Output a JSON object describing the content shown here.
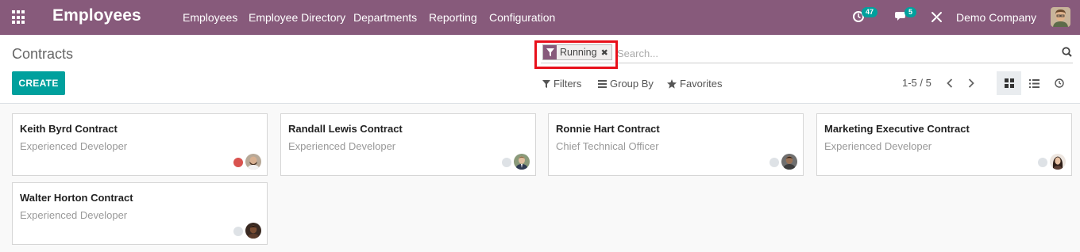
{
  "navbar": {
    "app_name": "Employees",
    "menu": [
      "Employees",
      "Employee Directory",
      "Departments",
      "Reporting",
      "Configuration"
    ],
    "activity_count": "47",
    "message_count": "5",
    "company": "Demo Company",
    "bg_color": "#875a7b"
  },
  "control_panel": {
    "breadcrumb": "Contracts",
    "create_label": "CREATE",
    "search": {
      "facet_label": "Running",
      "placeholder": "Search..."
    },
    "filters_label": "Filters",
    "group_by_label": "Group By",
    "favorites_label": "Favorites",
    "pager": "1-5 / 5",
    "active_view": "kanban"
  },
  "cards": [
    {
      "title": "Keith Byrd Contract",
      "subtitle": "Experienced Developer",
      "status_color": "#d9534f",
      "avatar": "man-beard"
    },
    {
      "title": "Randall Lewis Contract",
      "subtitle": "Experienced Developer",
      "status_color": "#dee2e6",
      "avatar": "man-suit"
    },
    {
      "title": "Ronnie Hart Contract",
      "subtitle": "Chief Technical Officer",
      "status_color": "#dee2e6",
      "avatar": "man-dark"
    },
    {
      "title": "Marketing Executive Contract",
      "subtitle": "Experienced Developer",
      "status_color": "#dee2e6",
      "avatar": "woman"
    },
    {
      "title": "Walter Horton Contract",
      "subtitle": "Experienced Developer",
      "status_color": "#dee2e6",
      "avatar": "man-dark"
    }
  ]
}
